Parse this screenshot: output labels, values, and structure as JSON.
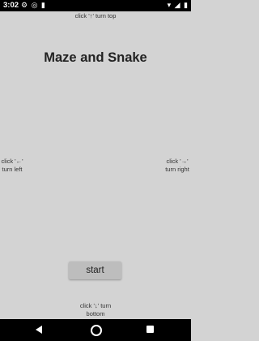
{
  "status_bar": {
    "time": "3:02",
    "left_icons": "⚙ ◎ ▮",
    "right_icons": "▾ ◢ ▮"
  },
  "hints": {
    "top": "click '↑' turn top",
    "left": "click '←' turn left",
    "right": "click '→' turn right",
    "bottom": "click '↓' turn bottom"
  },
  "title": "Maze and Snake",
  "start_label": "start",
  "colors": {
    "background": "#d3d3d3",
    "button": "#bdbdbd",
    "bars": "#000000"
  },
  "nav_icons": [
    "back-icon",
    "home-icon",
    "recents-icon"
  ]
}
